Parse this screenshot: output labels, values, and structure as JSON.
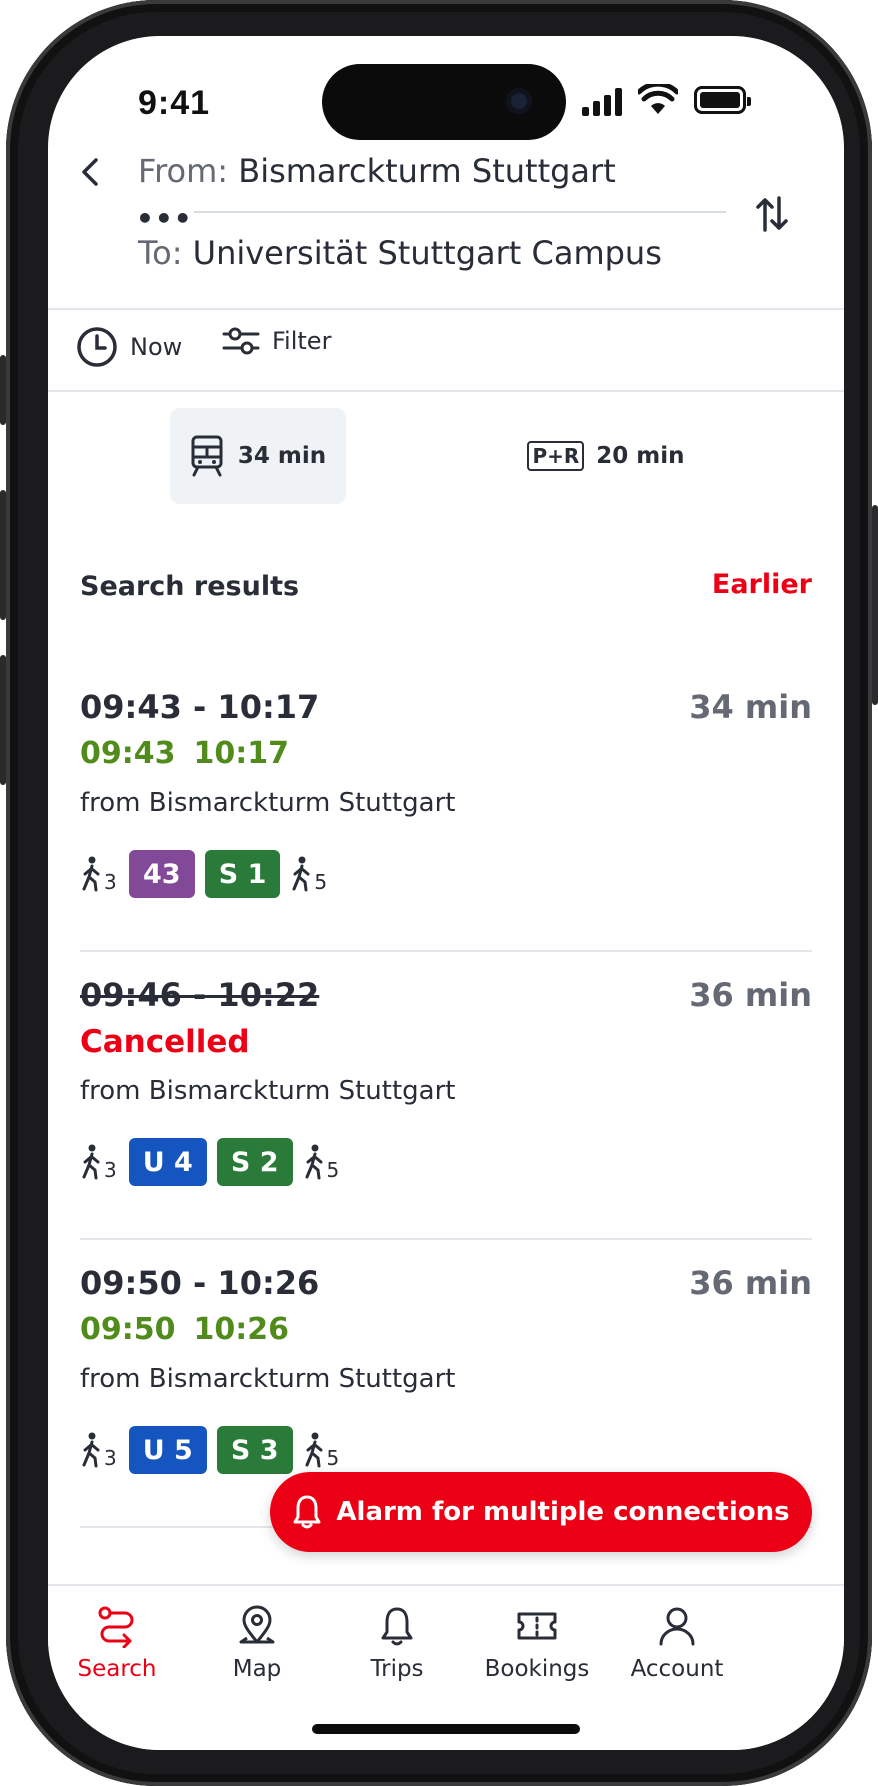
{
  "status": {
    "time": "9:41"
  },
  "header": {
    "from_label": "From:",
    "from_value": "Bismarckturm Stuttgart",
    "to_label": "To:",
    "to_value": "Universität Stuttgart Campus",
    "dots": "•••"
  },
  "options": {
    "time_label": "Now",
    "filter_label": "Filter"
  },
  "modes": [
    {
      "label": "34 min",
      "icon": "train-icon",
      "active": true
    },
    {
      "badge": "P+R",
      "label": "20 min",
      "icon": "park-and-ride-icon",
      "active": false
    }
  ],
  "results": {
    "title": "Search results",
    "earlier_label": "Earlier",
    "connections": [
      {
        "time": "09:43 - 10:17",
        "duration": "34 min",
        "realtime_dep": "09:43",
        "realtime_arr": "10:17",
        "from": "from Bismarckturm Stuttgart",
        "walk_before": "3",
        "lines": [
          {
            "name": "43",
            "color": "#814997"
          },
          {
            "name": "S 1",
            "color": "#2a7a3a"
          }
        ],
        "walk_after": "5"
      },
      {
        "time": "09:46 - 10:22",
        "duration": "36 min",
        "status": "Cancelled",
        "from": "from Bismarckturm Stuttgart",
        "walk_before": "3",
        "lines": [
          {
            "name": "U 4",
            "color": "#1455c0"
          },
          {
            "name": "S 2",
            "color": "#2a7a3a"
          }
        ],
        "walk_after": "5"
      },
      {
        "time": "09:50 - 10:26",
        "duration": "36 min",
        "realtime_dep": "09:50",
        "realtime_arr": "10:26",
        "from": "from Bismarckturm Stuttgart",
        "walk_before": "3",
        "lines": [
          {
            "name": "U 5",
            "color": "#1455c0"
          },
          {
            "name": "S 3",
            "color": "#2a7a3a"
          }
        ],
        "walk_after": "5"
      }
    ]
  },
  "alarm_button": {
    "label": "Alarm for multiple connections"
  },
  "tabbar": [
    {
      "label": "Search",
      "icon": "route-icon",
      "active": true
    },
    {
      "label": "Map",
      "icon": "map-pin-icon"
    },
    {
      "label": "Trips",
      "icon": "bell-icon"
    },
    {
      "label": "Bookings",
      "icon": "ticket-icon"
    },
    {
      "label": "Account",
      "icon": "person-icon"
    }
  ],
  "colors": {
    "accent": "#ec0016",
    "realtime": "#508b1b",
    "text": "#282d37",
    "muted": "#646973"
  }
}
